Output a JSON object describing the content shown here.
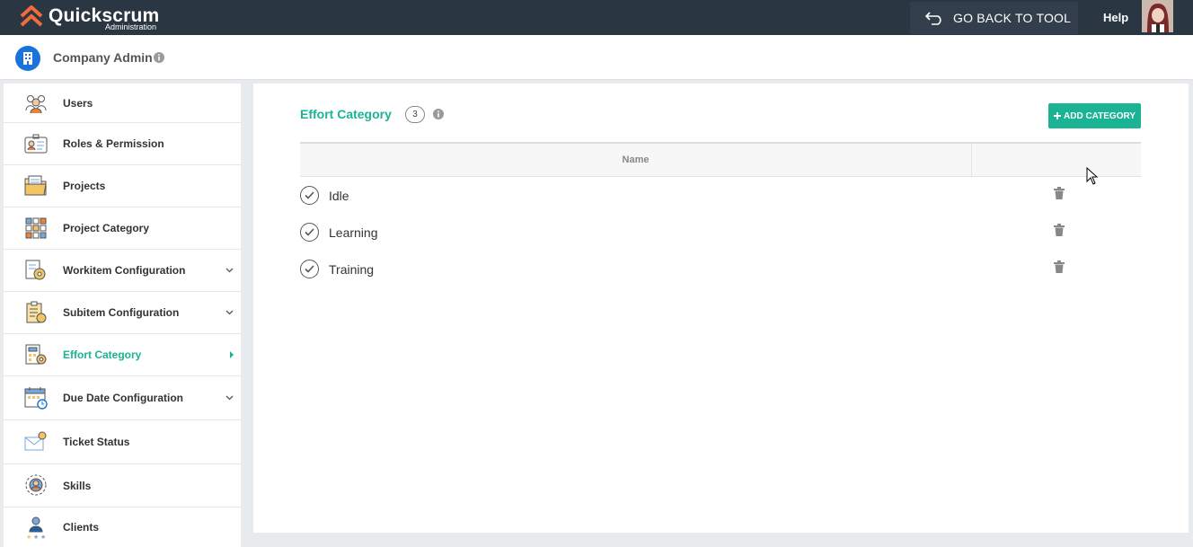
{
  "app": {
    "brand": "Quickscrum",
    "subtitle": "Administration",
    "go_back_label": "GO BACK TO TOOL",
    "help_label": "Help"
  },
  "company": {
    "label": "Company Admin"
  },
  "sidebar": {
    "items": [
      {
        "label": "Users",
        "icon": "users-icon"
      },
      {
        "label": "Roles & Permission",
        "icon": "id-card-icon"
      },
      {
        "label": "Projects",
        "icon": "folder-icon"
      },
      {
        "label": "Project Category",
        "icon": "grid-icon"
      },
      {
        "label": "Workitem Configuration",
        "icon": "gear-document-icon"
      },
      {
        "label": "Subitem Configuration",
        "icon": "checklist-icon"
      },
      {
        "label": "Effort Category",
        "icon": "calculator-gear-icon"
      },
      {
        "label": "Due Date Configuration",
        "icon": "calendar-clock-icon"
      },
      {
        "label": "Ticket Status",
        "icon": "envelope-icon"
      },
      {
        "label": "Skills",
        "icon": "skill-gear-icon"
      },
      {
        "label": "Clients",
        "icon": "client-icon"
      }
    ],
    "active": "Effort Category"
  },
  "main": {
    "title": "Effort Category",
    "count": "3",
    "add_button": "ADD CATEGORY",
    "columns": [
      "Name",
      ""
    ],
    "rows": [
      {
        "name": "Idle"
      },
      {
        "name": "Learning"
      },
      {
        "name": "Training"
      }
    ]
  },
  "colors": {
    "accent": "#1ab394",
    "topbar": "#2b3643",
    "brand_orange": "#f26b3a"
  }
}
